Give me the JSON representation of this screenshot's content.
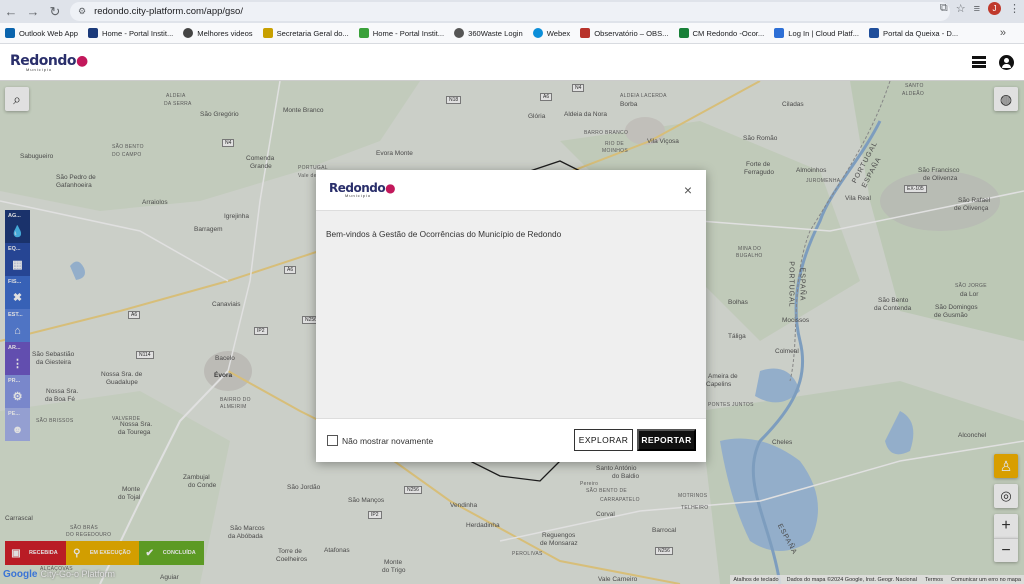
{
  "browser": {
    "url": "redondo.city-platform.com/app/gso/",
    "profile_initial": "J",
    "bookmarks": [
      {
        "label": "Outlook Web App",
        "color": "#0a64ad"
      },
      {
        "label": "Home - Portal Instit...",
        "color": "#1b3a7a"
      },
      {
        "label": "Melhores videos",
        "color": "#444444"
      },
      {
        "label": "Secretaria Geral do...",
        "color": "#c8a000"
      },
      {
        "label": "Home - Portal Instit...",
        "color": "#3aa13a"
      },
      {
        "label": "360Waste Login",
        "color": "#555555"
      },
      {
        "label": "Webex",
        "color": "#0b8ed9"
      },
      {
        "label": "Observatório – OBS...",
        "color": "#b8332b"
      },
      {
        "label": "CM Redondo -Ocor...",
        "color": "#188038"
      },
      {
        "label": "Log In | Cloud Platf...",
        "color": "#2d6fd6"
      },
      {
        "label": "Portal da Queixa - D...",
        "color": "#1f4e9b"
      }
    ],
    "more_bookmarks": "»"
  },
  "header": {
    "logo_text": "Redondo",
    "logo_sub": "Município"
  },
  "map": {
    "places": [
      {
        "t": "Sabugueiro"
      },
      {
        "t": "São Gregório"
      },
      {
        "t": "ALDEIA"
      },
      {
        "t": "DA SERRA"
      },
      {
        "t": "Monte Branco"
      },
      {
        "t": "SÃO BENTO"
      },
      {
        "t": "DO CAMPO"
      },
      {
        "t": "São Pedro de"
      },
      {
        "t": "Gafanhoeira"
      },
      {
        "t": "Comenda"
      },
      {
        "t": "Grande"
      },
      {
        "t": "Evora Monte"
      },
      {
        "t": "Arraiolos"
      },
      {
        "t": "Igrejinha"
      },
      {
        "t": "Barragem"
      },
      {
        "t": "Canaviais"
      },
      {
        "t": "Bacelo"
      },
      {
        "t": "Évora"
      },
      {
        "t": "São Sebastião"
      },
      {
        "t": "da Giesteira"
      },
      {
        "t": "Nossa Sra. de"
      },
      {
        "t": "Guadalupe"
      },
      {
        "t": "Nossa Sra."
      },
      {
        "t": "da Boa Fé"
      },
      {
        "t": "VALVERDE"
      },
      {
        "t": "SÃO BRISSOS"
      },
      {
        "t": "Nossa Sra."
      },
      {
        "t": "da Tourega"
      },
      {
        "t": "BAIRRO DO"
      },
      {
        "t": "ALMEIRIM"
      },
      {
        "t": "Zambujal"
      },
      {
        "t": "do Conde"
      },
      {
        "t": "Monte"
      },
      {
        "t": "do Tojal"
      },
      {
        "t": "São Jordão"
      },
      {
        "t": "São Manços"
      },
      {
        "t": "São Marcos"
      },
      {
        "t": "da Abóbada"
      },
      {
        "t": "Torre de"
      },
      {
        "t": "Coelheiros"
      },
      {
        "t": "Atafonas"
      },
      {
        "t": "Monte"
      },
      {
        "t": "do Trigo"
      },
      {
        "t": "Aguiar"
      },
      {
        "t": "Carrascal"
      },
      {
        "t": "SÃO BRÁS"
      },
      {
        "t": "DO REGEDOURO"
      },
      {
        "t": "ALCÁÇOVAS"
      },
      {
        "t": "Vendinha"
      },
      {
        "t": "Herdadinha"
      },
      {
        "t": "Reguengos"
      },
      {
        "t": "de Monsaraz"
      },
      {
        "t": "Borba"
      },
      {
        "t": "ALDEIA LACERDA"
      },
      {
        "t": "Glória"
      },
      {
        "t": "Aldeia da Nora"
      },
      {
        "t": "BARRO BRANCO"
      },
      {
        "t": "RIO DE"
      },
      {
        "t": "MOINHOS"
      },
      {
        "t": "Vila Viçosa"
      },
      {
        "t": "Ciladas"
      },
      {
        "t": "São Romão"
      },
      {
        "t": "Forte de"
      },
      {
        "t": "Ferragudo"
      },
      {
        "t": "Almoinhos"
      },
      {
        "t": "JUROMENHA"
      },
      {
        "t": "Vila Real"
      },
      {
        "t": "SANTO"
      },
      {
        "t": "ALDEÃO"
      },
      {
        "t": "São Francisco"
      },
      {
        "t": "de Olivenza"
      },
      {
        "t": "São Rafael"
      },
      {
        "t": "de Olivença"
      },
      {
        "t": "MINA DO"
      },
      {
        "t": "BUGALHO"
      },
      {
        "t": "Bolhas"
      },
      {
        "t": "Mocissos"
      },
      {
        "t": "São Bento"
      },
      {
        "t": "da Contenda"
      },
      {
        "t": "São Domingos"
      },
      {
        "t": "de Gusmão"
      },
      {
        "t": "Táliga"
      },
      {
        "t": "Colmeal"
      },
      {
        "t": "SÃO JORGE"
      },
      {
        "t": "da Lor"
      },
      {
        "t": "Cheles"
      },
      {
        "t": "Alconchel"
      },
      {
        "t": "Santo António"
      },
      {
        "t": "do Baldio"
      },
      {
        "t": "CARRAPATELO"
      },
      {
        "t": "Corval"
      },
      {
        "t": "MOTRINOS"
      },
      {
        "t": "TELHEIRO"
      },
      {
        "t": "Barrocal"
      },
      {
        "t": "PEROLIVAS"
      },
      {
        "t": "Vale Carneiro"
      },
      {
        "t": "PONTES JUNTOS"
      },
      {
        "t": "Ameira de"
      },
      {
        "t": "Capelins"
      },
      {
        "t": "PORTUGAL"
      },
      {
        "t": "ESPAÑA"
      },
      {
        "t": "PORTUGAL"
      },
      {
        "t": "ESPAÑA"
      },
      {
        "t": "ESPAÑA"
      },
      {
        "t": "PORTUGAL"
      },
      {
        "t": "Vale de"
      },
      {
        "t": "Pereiro"
      },
      {
        "t": "SÃO BENTO DE"
      },
      {
        "t": "ANA LOURA"
      }
    ],
    "roads": [
      "N18",
      "A6",
      "N4",
      "N4",
      "A6",
      "A6",
      "N114",
      "IP2",
      "N256",
      "N256",
      "EX-105",
      "N256",
      "IP2"
    ],
    "buttons": {
      "search_icon": "search-icon",
      "globe_icon": "globe-icon",
      "pegman_icon": "pegman-icon",
      "locate_icon": "locate-icon",
      "zoom_in": "+",
      "zoom_out": "−"
    }
  },
  "categories": [
    {
      "label": "AG...",
      "icon": "water-drop-icon",
      "color": "#1e3a7a"
    },
    {
      "label": "EQ...",
      "icon": "building-icon",
      "color": "#2c4fa8"
    },
    {
      "label": "FIS...",
      "icon": "tools-icon",
      "color": "#3f6fd0"
    },
    {
      "label": "EST...",
      "icon": "house-icon",
      "color": "#5b84e0"
    },
    {
      "label": "AR...",
      "icon": "traffic-light-icon",
      "color": "#7059c8"
    },
    {
      "label": "PR...",
      "icon": "gear-icon",
      "color": "#8a9ae8"
    },
    {
      "label": "PE...",
      "icon": "person-icon",
      "color": "#a9b6ee"
    }
  ],
  "legend": [
    {
      "label": "RECEBIDA",
      "icon": "inbox-icon",
      "color": "#d3202b"
    },
    {
      "label": "EM EXECUÇÃO",
      "icon": "marker-icon",
      "color": "#f0b400"
    },
    {
      "label": "CONCLUÍDA",
      "icon": "check-icon",
      "color": "#69b02a"
    }
  ],
  "footer": {
    "google": "Google",
    "platform": "City-Go-o Platform",
    "attrib": [
      "Atalhos de teclado",
      "Dados do mapa ©2024 Google, Inst. Geogr. Nacional",
      "Termos",
      "Comunicar um erro no mapa"
    ]
  },
  "modal": {
    "logo_text": "Redondo",
    "logo_sub": "Município",
    "close": "×",
    "message": "Bem-vindos à Gestão de Ocorrências do Município de Redondo",
    "checkbox_label": "Não mostrar novamente",
    "explore_label": "EXPLORAR",
    "report_label": "REPORTAR"
  }
}
